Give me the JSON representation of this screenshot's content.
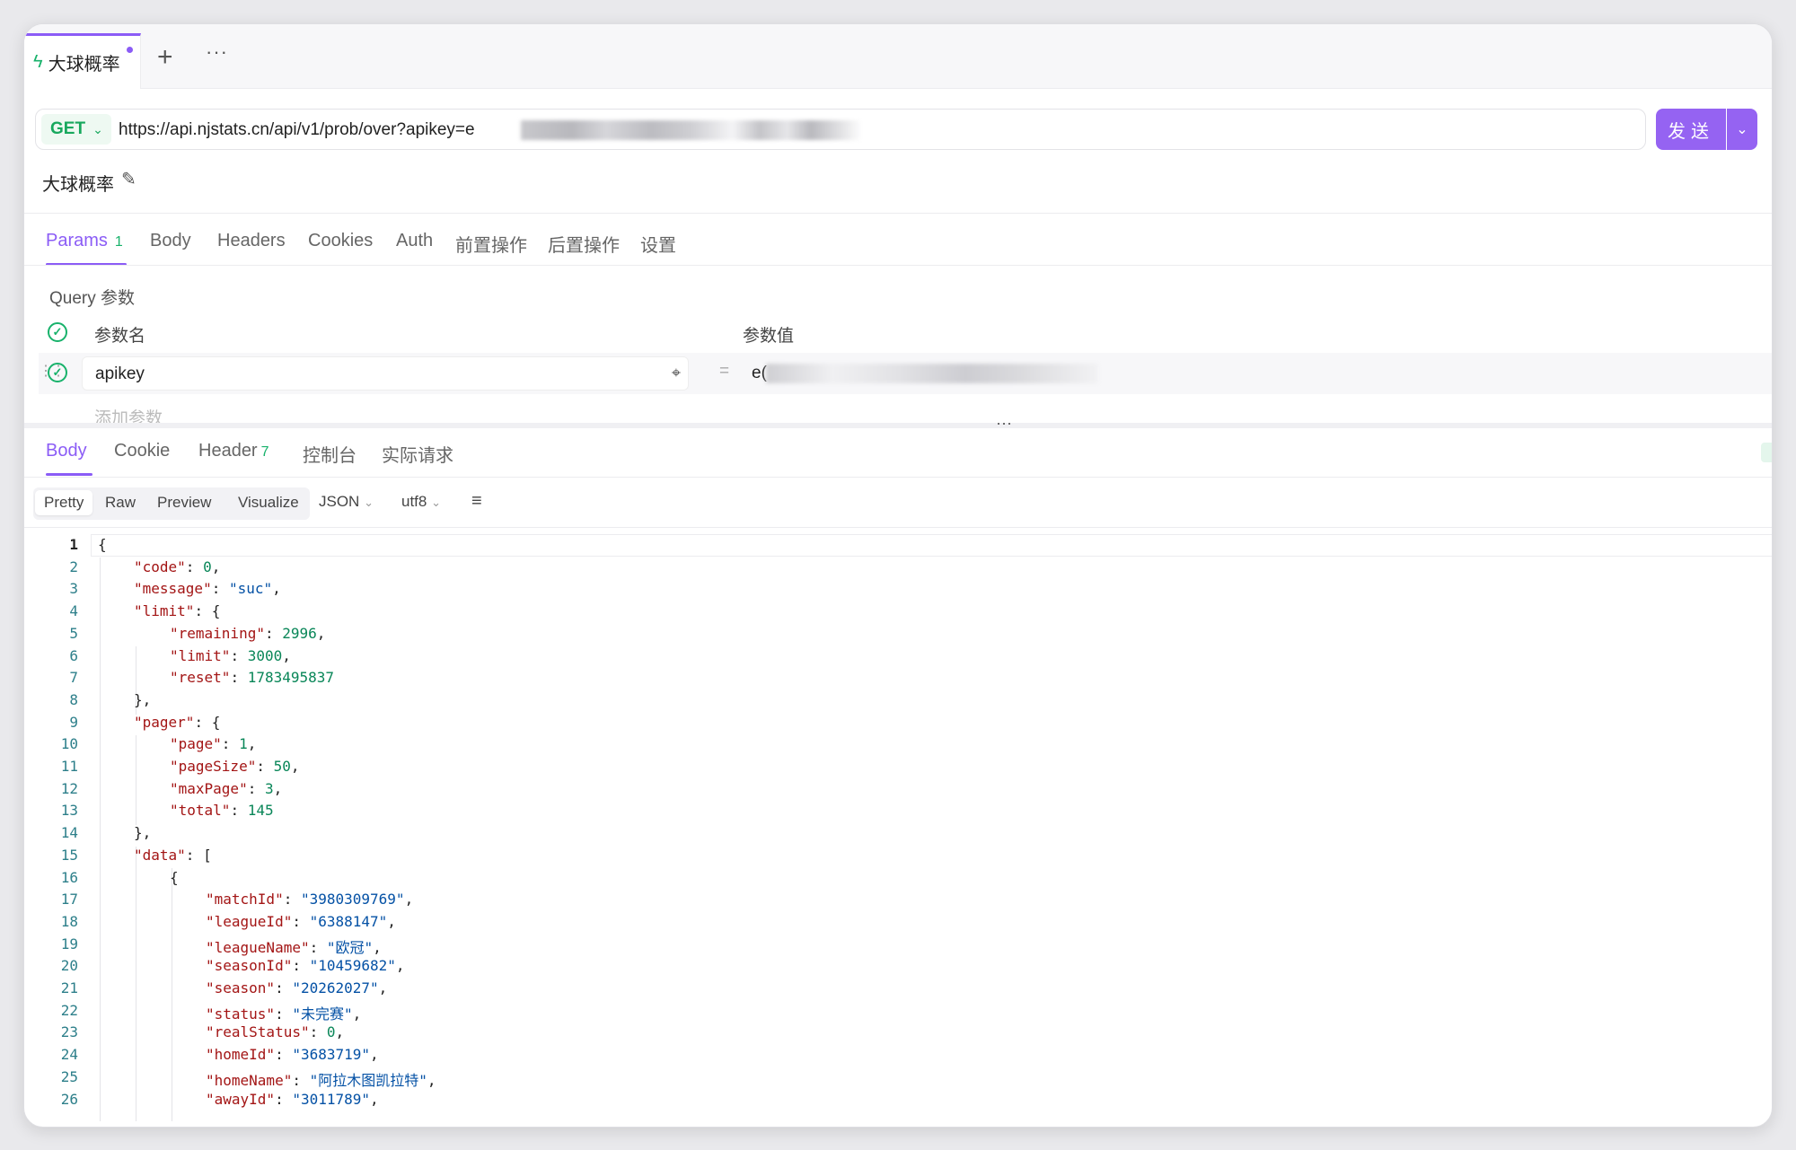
{
  "tabbar": {
    "tab_label": "大球概率",
    "plus": "+",
    "more": "···"
  },
  "request": {
    "method": "GET",
    "url": "https://api.njstats.cn/api/v1/prob/over?apikey=e",
    "send_label": "发送",
    "name": "大球概率"
  },
  "request_tabs": [
    {
      "label": "Params",
      "badge": "1"
    },
    {
      "label": "Body"
    },
    {
      "label": "Headers"
    },
    {
      "label": "Cookies"
    },
    {
      "label": "Auth"
    },
    {
      "label": "前置操作"
    },
    {
      "label": "后置操作"
    },
    {
      "label": "设置"
    }
  ],
  "params": {
    "section_title": "Query 参数",
    "col_name": "参数名",
    "col_value": "参数值",
    "row_key": "apikey",
    "row_value_prefix": "e(",
    "add_placeholder": "添加参数"
  },
  "response_tabs": [
    {
      "label": "Body"
    },
    {
      "label": "Cookie"
    },
    {
      "label": "Header",
      "badge": "7"
    },
    {
      "label": "控制台"
    },
    {
      "label": "实际请求"
    }
  ],
  "format": {
    "modes": [
      "Pretty",
      "Raw",
      "Preview",
      "Visualize"
    ],
    "type": "JSON",
    "encoding": "utf8"
  },
  "code_lines": [
    [
      {
        "t": "p",
        "v": "{"
      }
    ],
    [
      {
        "t": "k",
        "v": "\"code\""
      },
      {
        "t": "p",
        "v": ": "
      },
      {
        "t": "n",
        "v": "0"
      },
      {
        "t": "p",
        "v": ","
      }
    ],
    [
      {
        "t": "k",
        "v": "\"message\""
      },
      {
        "t": "p",
        "v": ": "
      },
      {
        "t": "s",
        "v": "\"suc\""
      },
      {
        "t": "p",
        "v": ","
      }
    ],
    [
      {
        "t": "k",
        "v": "\"limit\""
      },
      {
        "t": "p",
        "v": ": {"
      }
    ],
    [
      {
        "t": "k",
        "v": "\"remaining\""
      },
      {
        "t": "p",
        "v": ": "
      },
      {
        "t": "n",
        "v": "2996"
      },
      {
        "t": "p",
        "v": ","
      }
    ],
    [
      {
        "t": "k",
        "v": "\"limit\""
      },
      {
        "t": "p",
        "v": ": "
      },
      {
        "t": "n",
        "v": "3000"
      },
      {
        "t": "p",
        "v": ","
      }
    ],
    [
      {
        "t": "k",
        "v": "\"reset\""
      },
      {
        "t": "p",
        "v": ": "
      },
      {
        "t": "n",
        "v": "1783495837"
      }
    ],
    [
      {
        "t": "p",
        "v": "},"
      }
    ],
    [
      {
        "t": "k",
        "v": "\"pager\""
      },
      {
        "t": "p",
        "v": ": {"
      }
    ],
    [
      {
        "t": "k",
        "v": "\"page\""
      },
      {
        "t": "p",
        "v": ": "
      },
      {
        "t": "n",
        "v": "1"
      },
      {
        "t": "p",
        "v": ","
      }
    ],
    [
      {
        "t": "k",
        "v": "\"pageSize\""
      },
      {
        "t": "p",
        "v": ": "
      },
      {
        "t": "n",
        "v": "50"
      },
      {
        "t": "p",
        "v": ","
      }
    ],
    [
      {
        "t": "k",
        "v": "\"maxPage\""
      },
      {
        "t": "p",
        "v": ": "
      },
      {
        "t": "n",
        "v": "3"
      },
      {
        "t": "p",
        "v": ","
      }
    ],
    [
      {
        "t": "k",
        "v": "\"total\""
      },
      {
        "t": "p",
        "v": ": "
      },
      {
        "t": "n",
        "v": "145"
      }
    ],
    [
      {
        "t": "p",
        "v": "},"
      }
    ],
    [
      {
        "t": "k",
        "v": "\"data\""
      },
      {
        "t": "p",
        "v": ": ["
      }
    ],
    [
      {
        "t": "p",
        "v": "{"
      }
    ],
    [
      {
        "t": "k",
        "v": "\"matchId\""
      },
      {
        "t": "p",
        "v": ": "
      },
      {
        "t": "s",
        "v": "\"3980309769\""
      },
      {
        "t": "p",
        "v": ","
      }
    ],
    [
      {
        "t": "k",
        "v": "\"leagueId\""
      },
      {
        "t": "p",
        "v": ": "
      },
      {
        "t": "s",
        "v": "\"6388147\""
      },
      {
        "t": "p",
        "v": ","
      }
    ],
    [
      {
        "t": "k",
        "v": "\"leagueName\""
      },
      {
        "t": "p",
        "v": ": "
      },
      {
        "t": "s",
        "v": "\"欧冠\""
      },
      {
        "t": "p",
        "v": ","
      }
    ],
    [
      {
        "t": "k",
        "v": "\"seasonId\""
      },
      {
        "t": "p",
        "v": ": "
      },
      {
        "t": "s",
        "v": "\"10459682\""
      },
      {
        "t": "p",
        "v": ","
      }
    ],
    [
      {
        "t": "k",
        "v": "\"season\""
      },
      {
        "t": "p",
        "v": ": "
      },
      {
        "t": "s",
        "v": "\"20262027\""
      },
      {
        "t": "p",
        "v": ","
      }
    ],
    [
      {
        "t": "k",
        "v": "\"status\""
      },
      {
        "t": "p",
        "v": ": "
      },
      {
        "t": "s",
        "v": "\"未完赛\""
      },
      {
        "t": "p",
        "v": ","
      }
    ],
    [
      {
        "t": "k",
        "v": "\"realStatus\""
      },
      {
        "t": "p",
        "v": ": "
      },
      {
        "t": "n",
        "v": "0"
      },
      {
        "t": "p",
        "v": ","
      }
    ],
    [
      {
        "t": "k",
        "v": "\"homeId\""
      },
      {
        "t": "p",
        "v": ": "
      },
      {
        "t": "s",
        "v": "\"3683719\""
      },
      {
        "t": "p",
        "v": ","
      }
    ],
    [
      {
        "t": "k",
        "v": "\"homeName\""
      },
      {
        "t": "p",
        "v": ": "
      },
      {
        "t": "s",
        "v": "\"阿拉木图凯拉特\""
      },
      {
        "t": "p",
        "v": ","
      }
    ],
    [
      {
        "t": "k",
        "v": "\"awayId\""
      },
      {
        "t": "p",
        "v": ": "
      },
      {
        "t": "s",
        "v": "\"3011789\""
      },
      {
        "t": "p",
        "v": ","
      }
    ]
  ]
}
